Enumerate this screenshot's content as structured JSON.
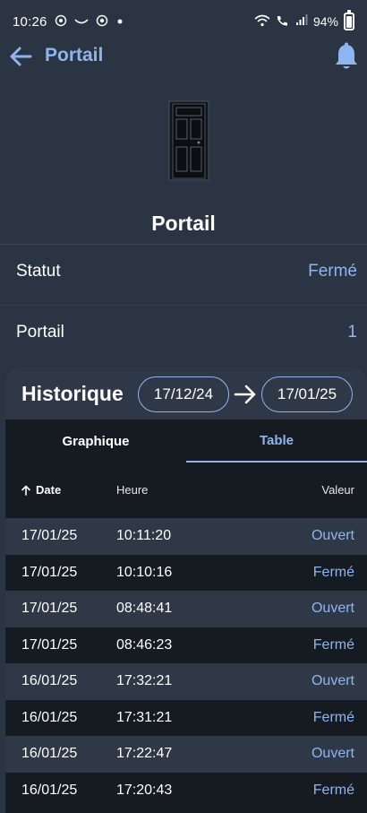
{
  "status_bar": {
    "time": "10:26",
    "battery": "94%",
    "left_icons": [
      "sync-icon",
      "tilde-icon",
      "circle-icon",
      "dot-icon"
    ],
    "right_icons": [
      "wifi-icon",
      "call-icon",
      "signal-icon",
      "battery-icon"
    ]
  },
  "app_bar": {
    "title": "Portail"
  },
  "device": {
    "name": "Portail"
  },
  "info": {
    "statut_label": "Statut",
    "statut_value": "Fermé",
    "portail_label": "Portail",
    "portail_value": "1"
  },
  "history": {
    "title": "Historique",
    "date_from": "17/12/24",
    "date_to": "17/01/25",
    "tabs": [
      {
        "label": "Graphique",
        "active": false
      },
      {
        "label": "Table",
        "active": true
      }
    ],
    "columns": {
      "date": "Date",
      "heure": "Heure",
      "valeur": "Valeur"
    },
    "rows": [
      {
        "date": "17/01/25",
        "heure": "10:11:20",
        "valeur": "Ouvert"
      },
      {
        "date": "17/01/25",
        "heure": "10:10:16",
        "valeur": "Fermé"
      },
      {
        "date": "17/01/25",
        "heure": "08:48:41",
        "valeur": "Ouvert"
      },
      {
        "date": "17/01/25",
        "heure": "08:46:23",
        "valeur": "Fermé"
      },
      {
        "date": "16/01/25",
        "heure": "17:32:21",
        "valeur": "Ouvert"
      },
      {
        "date": "16/01/25",
        "heure": "17:31:21",
        "valeur": "Fermé"
      },
      {
        "date": "16/01/25",
        "heure": "17:22:47",
        "valeur": "Ouvert"
      },
      {
        "date": "16/01/25",
        "heure": "17:20:43",
        "valeur": "Fermé"
      }
    ]
  },
  "colors": {
    "background": "#2b3442",
    "accent": "#8fb5f0",
    "card": "#161b22",
    "row_alt": "#2e3847"
  }
}
